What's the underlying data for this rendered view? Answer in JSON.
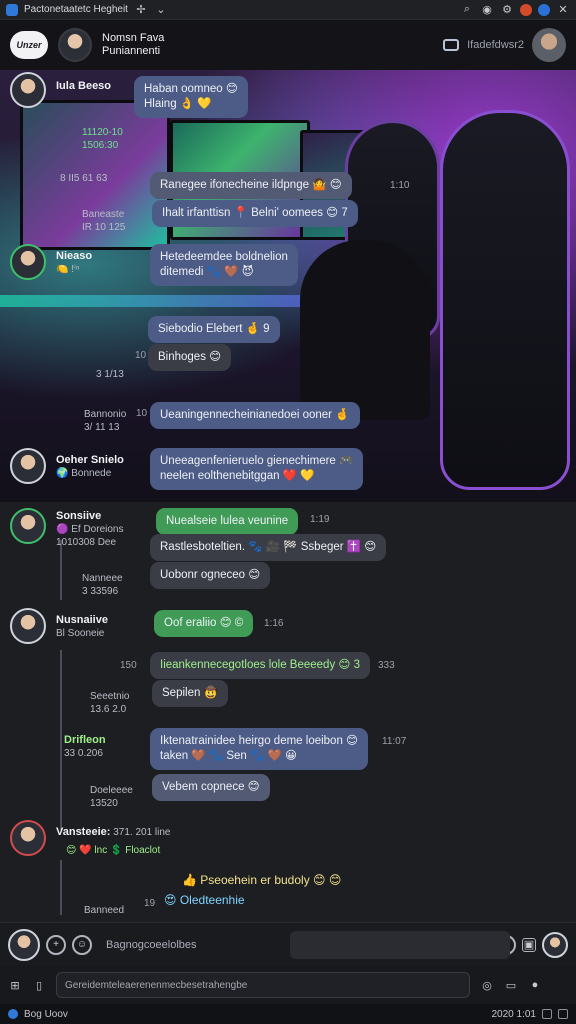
{
  "window": {
    "title": "Pactonetaatetc Hegheit"
  },
  "header": {
    "brand": "Unzer",
    "contact_name_line1": "Nomsn Fava",
    "contact_name_line2": "Puniannenti",
    "status": "Ifadefdwsr2"
  },
  "messages": [
    {
      "name": "Iula Beeso",
      "sub1": "",
      "bubble_line1": "Haban oomneo 😊",
      "bubble_line2": "Hlaing 👌 💛"
    },
    {
      "sub1": "11120-10",
      "sub2": "1506:30",
      "sub3": "8 II5 61 63"
    },
    {
      "bubble": "Ranegee ifonecheine ildpnge 🤷 😊",
      "ts": "1:10"
    },
    {
      "bubble": "Ihalt irfanttisn 📍 Belni' oomees 😊 7"
    },
    {
      "meta_a": "Baneaste",
      "meta_b": "IR 10 125"
    },
    {
      "name": "Nieaso",
      "sub1": "🍋 !ⁱⁿ",
      "bubble_line1": "Hetedeemdee boldnelion",
      "bubble_line2": "ditemedi 🐾 🤎 😈"
    },
    {
      "bubble": "Siebodio Elebert 🤞 9"
    },
    {
      "bubble": "Binhoges 😊",
      "ts": "10"
    },
    {
      "meta": "3 1/13"
    },
    {
      "meta_a": "Bannonio",
      "meta_b": "3/ 11 13"
    },
    {
      "bubble": "Ueaningennecheinianedoei ooner 🤞",
      "ts": "10"
    },
    {
      "name": "Oeher Snielo",
      "sub1": "🌍 Bonnede",
      "bubble_line1": "Uneeagenfenieruelo gienechimere 🎮",
      "bubble_line2": "neelen eolthenebitggan ❤️ 💛"
    },
    {
      "name": "Sonsiive",
      "sub1": "🟣 Ef Doreions",
      "sub2": "1010308 Dee",
      "bubble_green": "Nuealseie lulea veunine",
      "ts_green": "1:19"
    },
    {
      "bubble": "Rastlesboteltien. 🐾 🎥 🏁 Ssbeger ✝️ 😊"
    },
    {
      "meta_a": "Nanneee",
      "meta_b": "3 33596",
      "bubble": "Uobonr ogneceo 😊"
    },
    {
      "name": "Nusnaiive",
      "sub1": "Bl Sooneie",
      "bubble_green": "Oof eraliio 😊 ©",
      "ts_green": "1:16"
    },
    {
      "bubble": "Iieankennecegotloes lole Beeeedy 😊 3",
      "ts": "150",
      "ts2": "333"
    },
    {
      "meta_a": "Seeetnio",
      "meta_b": "13.6 2.0",
      "bubble": "Sepilen 🤠"
    },
    {
      "name": "Drifleon",
      "sub1": "33 0.206",
      "bubble_line1": "Iktenatrainidee heirgo deme loeibon 😊",
      "bubble_line2": "taken 🤎 🐾 Sen 🐾 🤎 😀",
      "ts": "11:07"
    },
    {
      "meta_a": "Doeleeee",
      "meta_b": "13520",
      "bubble": "Vebem copnece 😊"
    },
    {
      "name": "Vansteeie:",
      "sub1": "371. 201 line",
      "sub2": "😊 ❤️ lnc 💲 Floaclot"
    },
    {
      "line1": "👍 Pseoehein er budoly 😊 😊",
      "line2": "😍 Oledteenhie",
      "ts": "19",
      "meta_a": "Banneed"
    }
  ],
  "composer": {
    "label": "Bagnogcoeelolbes",
    "placeholder": "Gereidemteleaerenenmecbesetrahengbe"
  },
  "statusbar": {
    "left": "Bog Uoov",
    "right": "2020 1:01"
  }
}
